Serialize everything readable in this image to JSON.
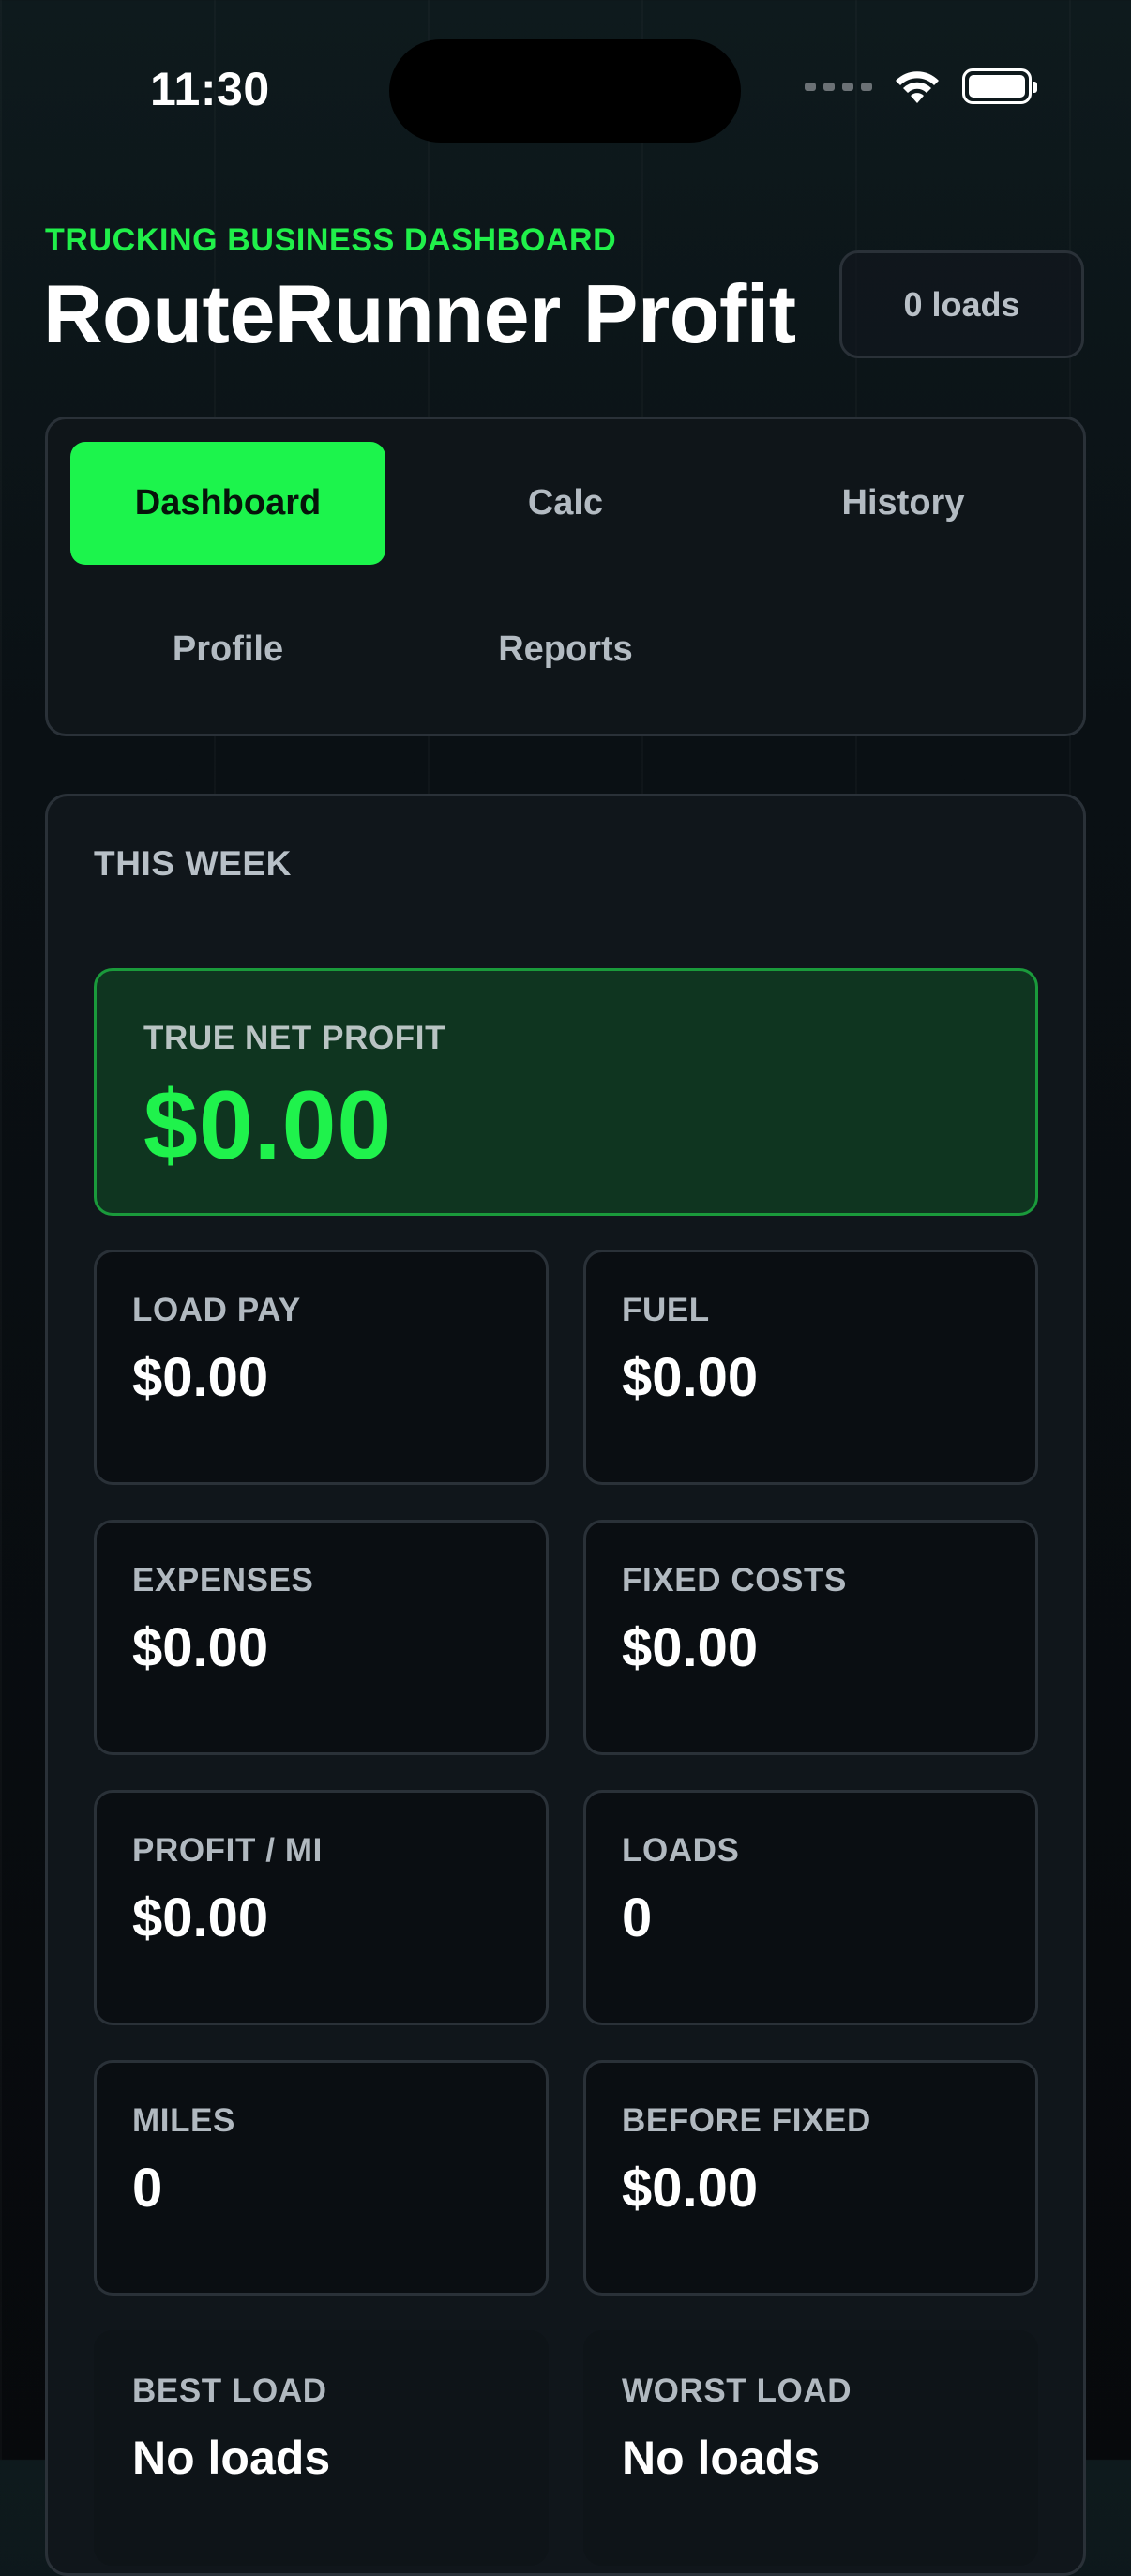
{
  "status_bar": {
    "time": "11:30"
  },
  "header": {
    "eyebrow": "TRUCKING BUSINESS DASHBOARD",
    "title": "RouteRunner Profit",
    "loads_badge": "0 loads"
  },
  "tabs": [
    {
      "label": "Dashboard",
      "active": true
    },
    {
      "label": "Calc",
      "active": false
    },
    {
      "label": "History",
      "active": false
    },
    {
      "label": "Profile",
      "active": false
    },
    {
      "label": "Reports",
      "active": false
    }
  ],
  "summary": {
    "period_label": "THIS WEEK",
    "net_profit_label": "TRUE NET PROFIT",
    "net_profit_value": "$0.00",
    "stats": [
      {
        "label": "LOAD PAY",
        "value": "$0.00"
      },
      {
        "label": "FUEL",
        "value": "$0.00"
      },
      {
        "label": "EXPENSES",
        "value": "$0.00"
      },
      {
        "label": "FIXED COSTS",
        "value": "$0.00"
      },
      {
        "label": "PROFIT / MI",
        "value": "$0.00"
      },
      {
        "label": "LOADS",
        "value": "0"
      },
      {
        "label": "MILES",
        "value": "0"
      },
      {
        "label": "BEFORE FIXED",
        "value": "$0.00"
      },
      {
        "label": "BEST LOAD",
        "value": "No loads"
      },
      {
        "label": "WORST LOAD",
        "value": "No loads"
      }
    ]
  },
  "colors": {
    "accent": "#1cf44c",
    "background": "#0a1014",
    "card": "#10161b",
    "border": "#2a3138"
  }
}
